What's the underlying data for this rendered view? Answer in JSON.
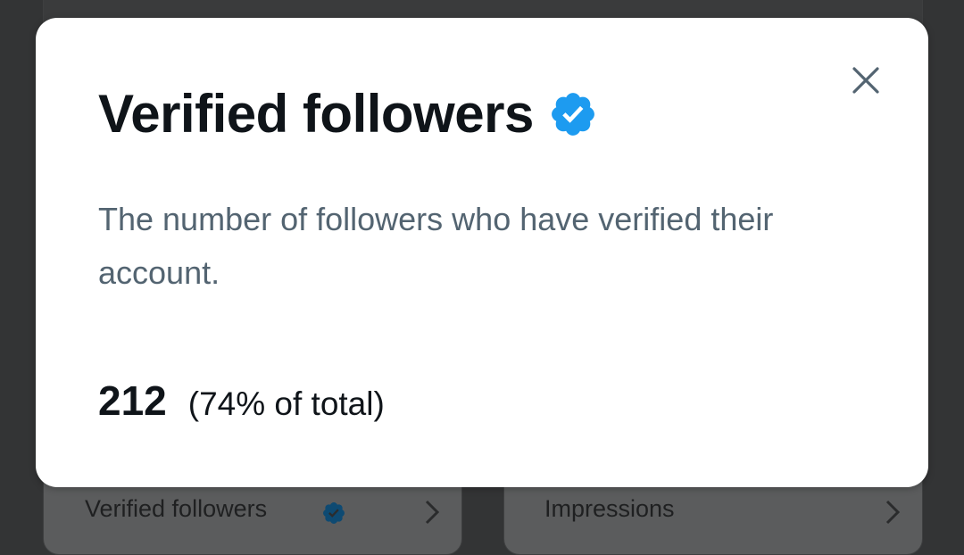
{
  "background": {
    "cards": {
      "left_label": "Verified followers",
      "right_label": "Impressions"
    }
  },
  "modal": {
    "title": "Verified followers",
    "title_icon": "verified-badge-icon",
    "close_icon": "close-icon",
    "description": "The number of followers who have verified their account.",
    "stat_value": "212",
    "stat_percent": "(74% of total)"
  },
  "colors": {
    "accent": "#1d9bf0",
    "title_text": "#0f1419",
    "secondary_text": "#536471",
    "overlay": "#333435"
  }
}
